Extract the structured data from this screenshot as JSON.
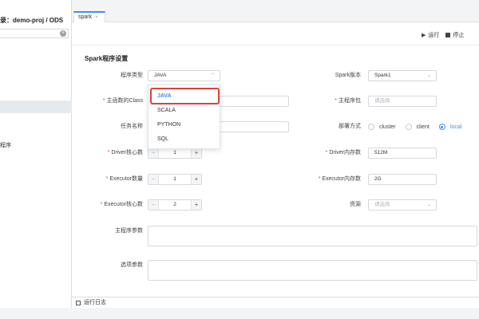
{
  "sidebar": {
    "title": "录：demo-proj / ODS",
    "tree_item_label": "程序"
  },
  "tab": {
    "label": "spark",
    "close": "×"
  },
  "toolbar": {
    "run_label": "运行",
    "stop_label": "停止"
  },
  "form": {
    "section_title": "Spark程序设置",
    "program_type": {
      "label": "程序类型",
      "value": "JAVA"
    },
    "spark_version": {
      "label": "Spark版本",
      "value": "Spark1"
    },
    "main_class": {
      "label": "主函数的Class",
      "value": ""
    },
    "main_jar": {
      "label": "主程序包",
      "placeholder": "请选择"
    },
    "task_name": {
      "label": "任务名称",
      "value": ""
    },
    "deploy_mode": {
      "label": "部署方式",
      "options": [
        "cluster",
        "client",
        "local"
      ],
      "selected": "local"
    },
    "driver_cores": {
      "label": "Driver核心数",
      "value": "1"
    },
    "driver_memory": {
      "label": "Driver内存数",
      "value": "512M"
    },
    "executor_count": {
      "label": "Executor数量",
      "value": "1"
    },
    "executor_memory": {
      "label": "Executor内存数",
      "value": "2G"
    },
    "executor_cores": {
      "label": "Executor核心数",
      "value": "2"
    },
    "resources": {
      "label": "资源",
      "placeholder": "请选择"
    },
    "main_args": {
      "label": "主程序参数"
    },
    "options": {
      "label": "选项参数"
    }
  },
  "dropdown": {
    "options": [
      "JAVA",
      "SCALA",
      "PYTHON",
      "SQL"
    ],
    "selected": "JAVA"
  },
  "footer": {
    "log_label": "运行日志"
  },
  "colors": {
    "accent": "#3d8ef8",
    "highlight_border": "#d9423a",
    "required": "#e54545"
  }
}
